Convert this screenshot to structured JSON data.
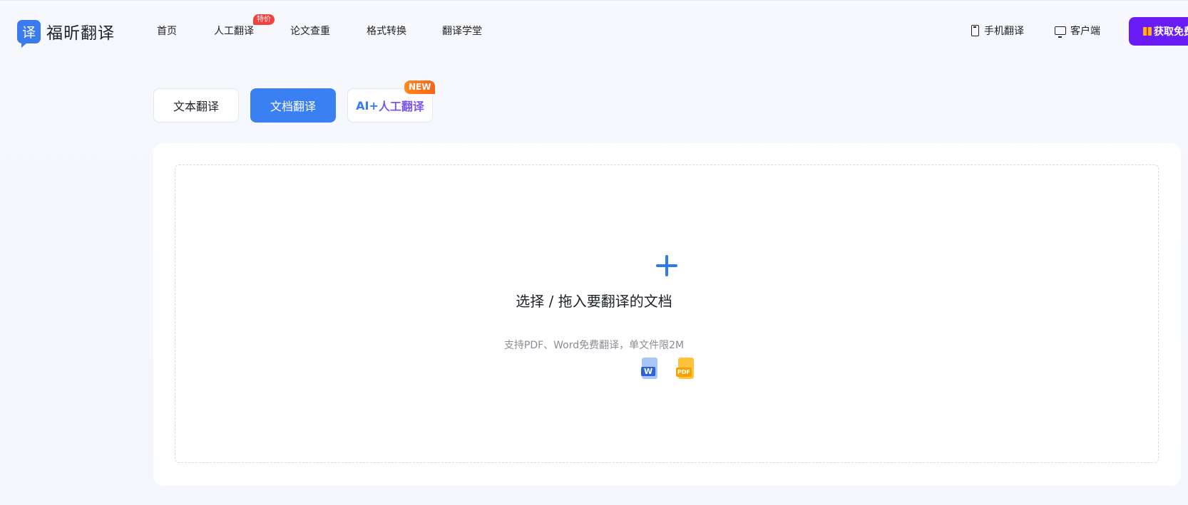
{
  "header": {
    "logo_glyph": "译",
    "logo_text": "福昕翻译",
    "nav": [
      {
        "label": "首页"
      },
      {
        "label": "人工翻译",
        "badge": "特价"
      },
      {
        "label": "论文查重"
      },
      {
        "label": "格式转换"
      },
      {
        "label": "翻译学堂"
      }
    ],
    "mobile_label": "手机翻译",
    "client_label": "客户端",
    "cta_label": "获取免费"
  },
  "tabs": [
    {
      "label": "文本翻译",
      "active": false
    },
    {
      "label": "文档翻译",
      "active": true
    },
    {
      "label_part1": "AI+",
      "label_part2": "人工翻译",
      "badge": "NEW",
      "active": false
    }
  ],
  "upload": {
    "title": "选择 / 拖入要翻译的文档",
    "hint": "支持PDF、Word免费翻译，单文件限2M",
    "file_types": [
      {
        "icon": "word-file-icon",
        "label": "W"
      },
      {
        "icon": "pdf-file-icon",
        "label": "PDF"
      }
    ]
  },
  "colors": {
    "accent": "#3b80f2",
    "cta": "#6a1cf6",
    "badge_hot": "#f2413b",
    "badge_new": "#f8631a"
  }
}
